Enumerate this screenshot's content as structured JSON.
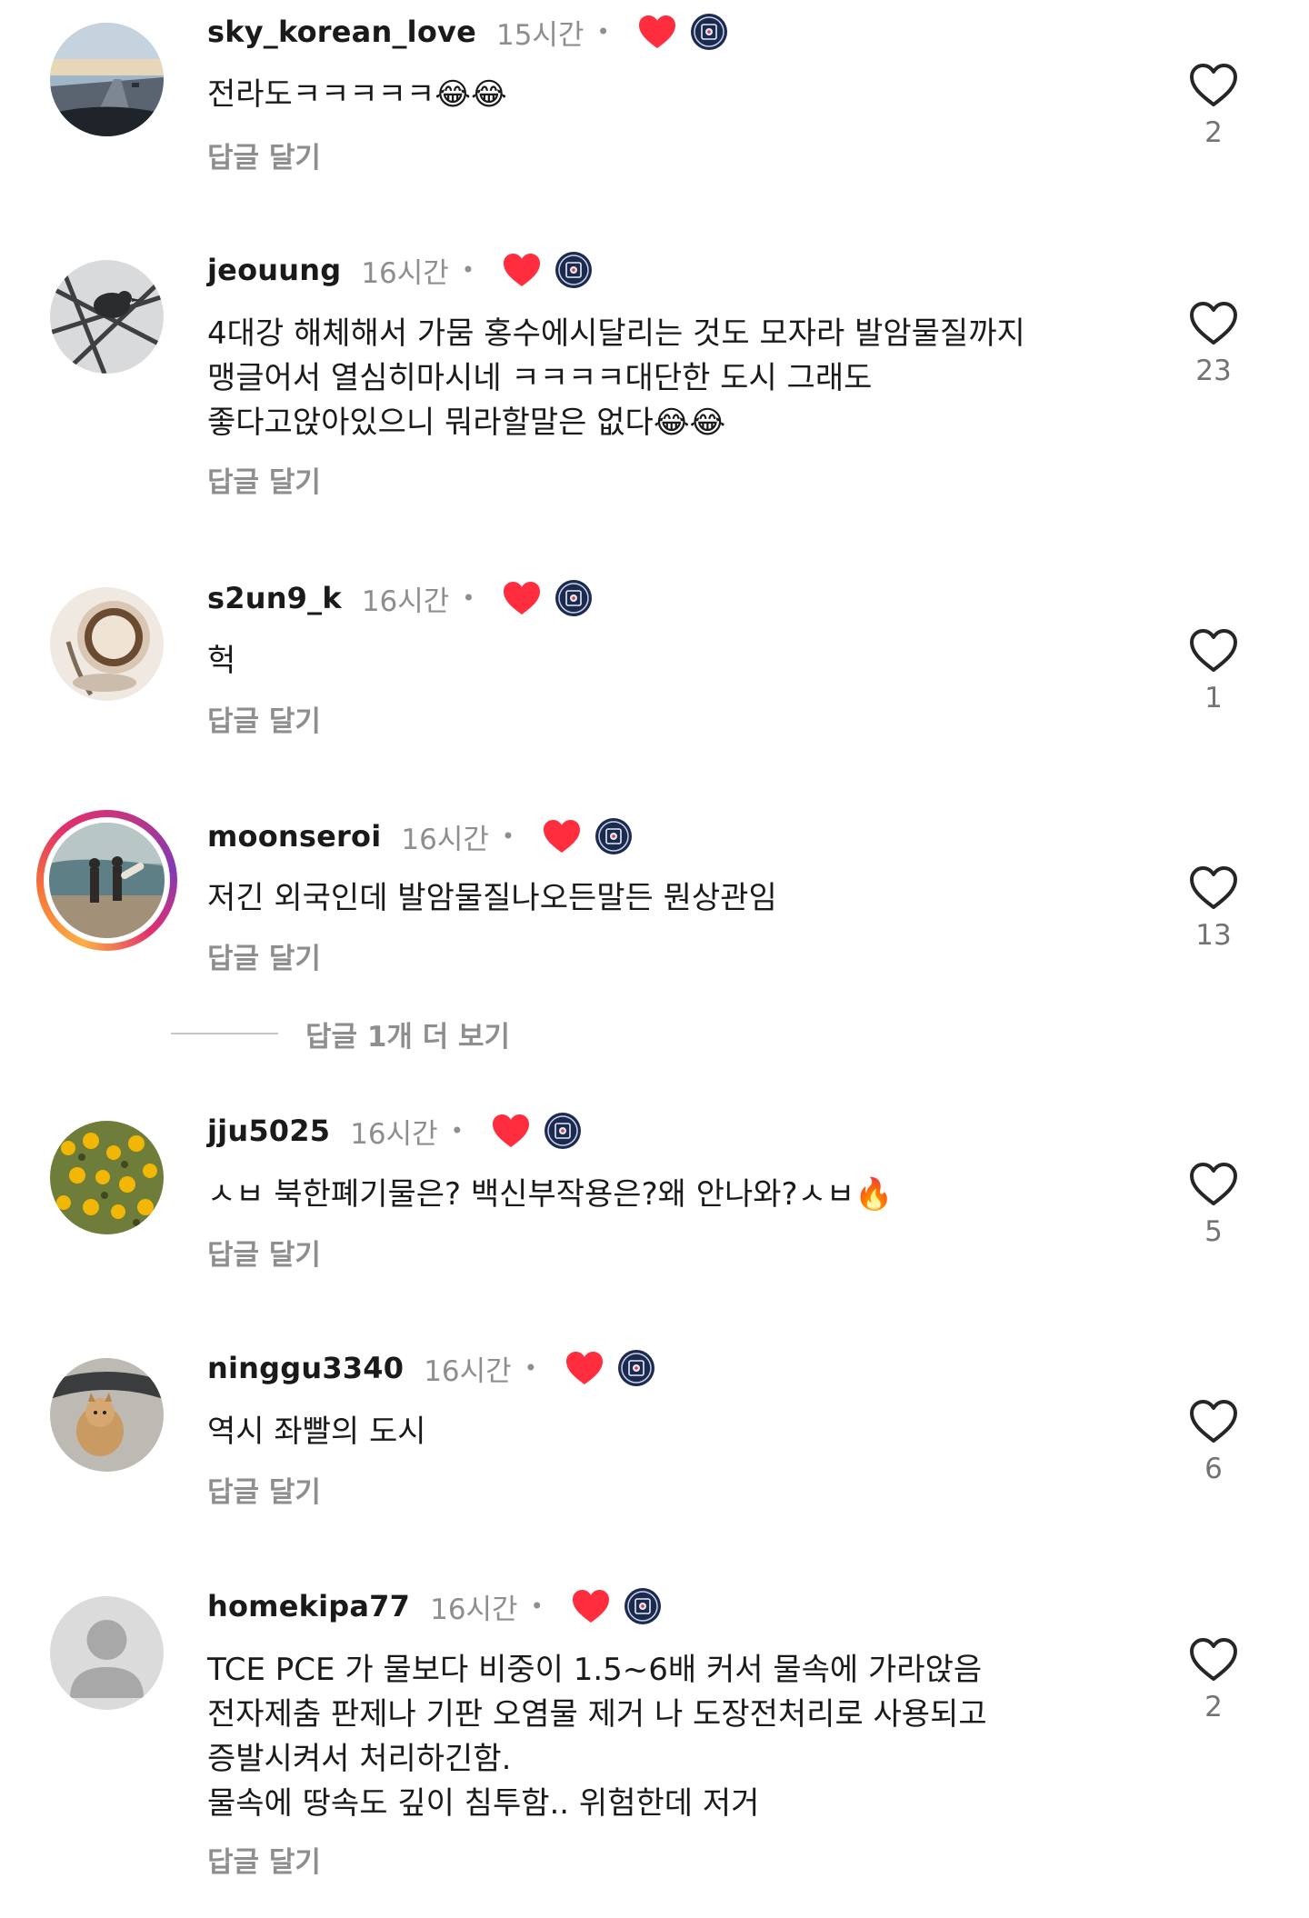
{
  "reply_label": "답글 달기",
  "more_replies_label": "답글 1개 더 보기",
  "colors": {
    "heart_red": "#ff2d3d",
    "muted": "#8e8e8e",
    "text": "#1a1a1a"
  },
  "comments": [
    {
      "username": "sky_korean_love",
      "time": "15시간",
      "text": "전라도ㅋㅋㅋㅋㅋ😂😂",
      "likes": "2",
      "avatar": "highway-photo"
    },
    {
      "username": "jeouung",
      "time": "16시간",
      "text": "4대강 해체해서 가뭄 홍수에시달리는 것도 모자라 발암물질까지\n맹글어서 열심히마시네 ㅋㅋㅋㅋ대단한 도시 그래도\n좋다고앉아있으니 뭐라할말은 없다😂😂",
      "likes": "23",
      "avatar": "bird-photo"
    },
    {
      "username": "s2un9_k",
      "time": "16시간",
      "text": "헉",
      "likes": "1",
      "avatar": "coffee-photo"
    },
    {
      "username": "moonseroi",
      "time": "16시간",
      "text": "저긴 외국인데 발암물질나오든말든 뭔상관임",
      "likes": "13",
      "avatar": "surf-photo"
    },
    {
      "username": "jju5025",
      "time": "16시간",
      "text": "ㅅㅂ 북한폐기물은? 백신부작용은?왜 안나와?ㅅㅂ🔥",
      "likes": "5",
      "avatar": "flowers-photo"
    },
    {
      "username": "ninggu3340",
      "time": "16시간",
      "text": "역시 좌빨의 도시",
      "likes": "6",
      "avatar": "puppy-photo"
    },
    {
      "username": "homekipa77",
      "time": "16시간",
      "text": "TCE PCE 가 물보다 비중이 1.5~6배 커서 물속에 가라앉음\n전자제춤 판제나 기판 오염물 제거 나 도장전처리로 사용되고\n증발시켜서 처리하긴함.\n물속에 땅속도 깊이 침투함.. 위험한데 저거",
      "likes": "2",
      "avatar": "default-person-icon"
    }
  ]
}
